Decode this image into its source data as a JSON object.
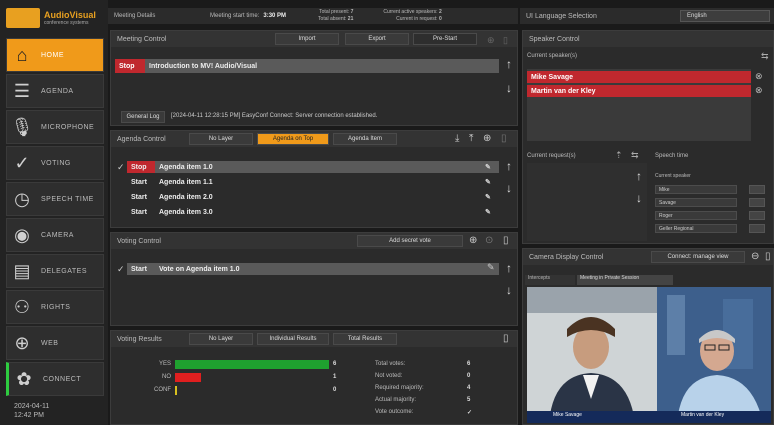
{
  "brand": {
    "name": "AudioVisual",
    "sub": "conference systems"
  },
  "sidebar": {
    "items": [
      {
        "label": "HOME",
        "icon": "home-icon",
        "glyph": "⌂"
      },
      {
        "label": "AGENDA",
        "icon": "agenda-icon",
        "glyph": "☰"
      },
      {
        "label": "MICROPHONE",
        "icon": "microphone-icon",
        "glyph": "🎙"
      },
      {
        "label": "VOTING",
        "icon": "voting-icon",
        "glyph": "✓"
      },
      {
        "label": "SPEECH TIME",
        "icon": "clock-icon",
        "glyph": "◷"
      },
      {
        "label": "CAMERA",
        "icon": "camera-icon",
        "glyph": "◉"
      },
      {
        "label": "DELEGATES",
        "icon": "delegates-icon",
        "glyph": "▤"
      },
      {
        "label": "RIGHTS",
        "icon": "rights-icon",
        "glyph": "⚇"
      },
      {
        "label": "WEB",
        "icon": "globe-icon",
        "glyph": "⊕"
      },
      {
        "label": "CONNECT",
        "icon": "connect-icon",
        "glyph": "✿"
      }
    ],
    "date": "2024-04-11",
    "time": "12:42 PM"
  },
  "topbar": {
    "meeting_details": "Meeting Details",
    "start_label": "Meeting start time:",
    "start_value": "3:30 PM",
    "present_label": "Total present:",
    "present_value": "7",
    "absent_label": "Total absent:",
    "absent_value": "21",
    "active_speakers_label": "Current active speakers:",
    "active_speakers_value": "2",
    "requests_label": "Current in request:",
    "requests_value": "0",
    "language_label": "UI Language Selection",
    "language_value": "English"
  },
  "meeting_control": {
    "title": "Meeting Control",
    "import": "Import",
    "export": "Export",
    "prestart": "Pre-Start",
    "stop": "Stop",
    "meeting_name": "Introduction to MV! Audio/Visual",
    "general_log": "General Log",
    "log_line": "[2024-04-11 12:28:15 PM] EasyConf Connect: Server connection established."
  },
  "agenda_control": {
    "title": "Agenda Control",
    "no_layer": "No Layer",
    "agenda_on_top": "Agenda on Top",
    "agenda_item": "Agenda Item",
    "rows": [
      {
        "state": "Stop",
        "label": "Agenda item 1.0"
      },
      {
        "state": "Start",
        "label": "Agenda item 1.1"
      },
      {
        "state": "Start",
        "label": "Agenda item 2.0"
      },
      {
        "state": "Start",
        "label": "Agenda item 3.0"
      }
    ]
  },
  "voting_control": {
    "title": "Voting Control",
    "add_secret": "Add secret vote",
    "state": "Start",
    "label": "Vote on Agenda item 1.0"
  },
  "voting_results": {
    "title": "Voting Results",
    "no_layer": "No Layer",
    "individual": "Individual Results",
    "total": "Total Results",
    "rows": [
      {
        "label": "YES",
        "value": "6"
      },
      {
        "label": "NO",
        "value": "1"
      },
      {
        "label": "CONF",
        "value": "0"
      }
    ],
    "stats": [
      {
        "label": "Total votes:",
        "value": "6"
      },
      {
        "label": "Not voted:",
        "value": "0"
      },
      {
        "label": "Required majority:",
        "value": "4"
      },
      {
        "label": "Actual majority:",
        "value": "5"
      },
      {
        "label": "Vote outcome:",
        "value": "✓"
      }
    ]
  },
  "speaker_control": {
    "title": "Speaker Control",
    "current_speakers": "Current speaker(s)",
    "speakers": [
      "Mike Savage",
      "Martin van der Kley"
    ],
    "current_requests": "Current request(s)",
    "speech_time": "Speech time",
    "current_speaker": "Current speaker",
    "time_rows": [
      "Mike",
      "Savage",
      "Roger",
      "Geller Regional"
    ]
  },
  "camera": {
    "title": "Camera Display Control",
    "connect": "Connect: manage view",
    "tab_a": "Intercepts",
    "tab_b": "Meeting in Private Session",
    "name_left": "Mike Savage",
    "name_right": "Martin van der Kley"
  }
}
